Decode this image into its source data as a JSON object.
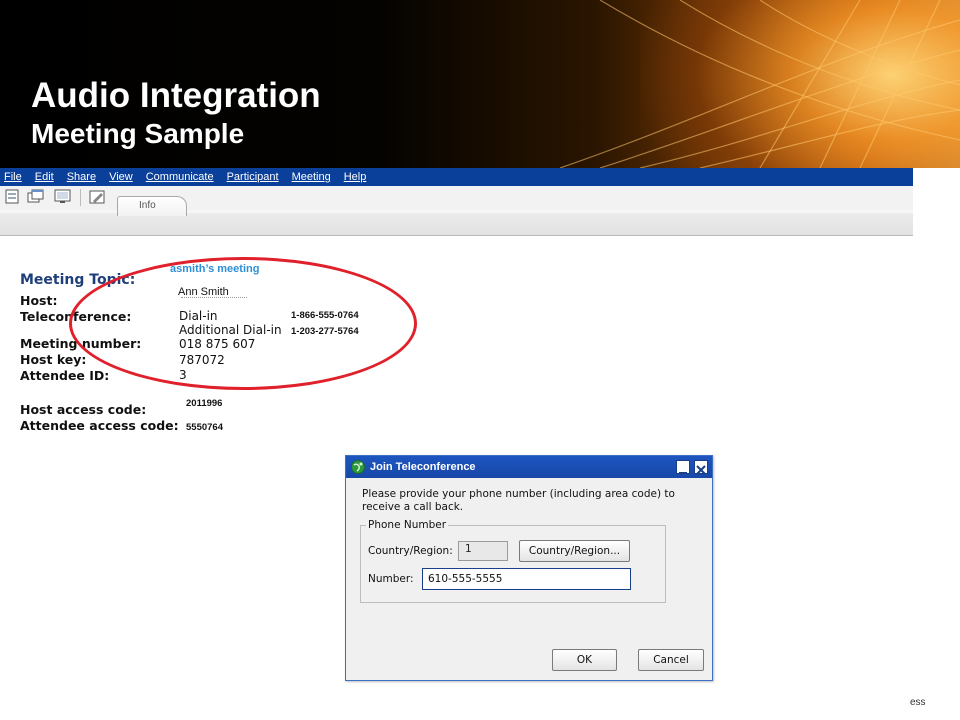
{
  "slide": {
    "title": "Audio Integration",
    "subtitle": "Meeting Sample"
  },
  "menu": {
    "items": [
      "File",
      "Edit",
      "Share",
      "View",
      "Communicate",
      "Participant",
      "Meeting",
      "Help"
    ]
  },
  "tab": {
    "label": "Info"
  },
  "info": {
    "labels": {
      "topic": "Meeting Topic:",
      "host": "Host:",
      "teleconference": "Teleconference:",
      "meeting_number": "Meeting number:",
      "host_key": "Host key:",
      "attendee_id": "Attendee ID:",
      "host_access_code": "Host access code:",
      "attendee_access_code": "Attendee access code:"
    },
    "topic": "asmith’s meeting",
    "host": "Ann Smith",
    "dial_in": "Dial-in",
    "additional_dial_in": "Additional Dial-in",
    "dial_in_number": "1-866-555-0764",
    "additional_dial_in_number": "1-203-277-5764",
    "meeting_number": "018 875 607",
    "host_key": "787072",
    "attendee_id": "3",
    "host_access_code": "2011996",
    "attendee_access_code": "5550764"
  },
  "dialog": {
    "title": "Join Teleconference",
    "message": "Please provide your phone number (including area code) to receive a call back.",
    "group_label": "Phone Number",
    "country_label": "Country/Region:",
    "country_code": "1",
    "country_button": "Country/Region...",
    "number_label": "Number:",
    "number_value": "610-555-5555",
    "ok_label": "OK",
    "cancel_label": "Cancel"
  },
  "footer": {
    "fragment": "ess"
  },
  "colors": {
    "menubar": "#0a3f9a",
    "topic_value": "#2e8fd6",
    "highlight": "#e0202a",
    "dialog_title": "#1d55c0"
  }
}
